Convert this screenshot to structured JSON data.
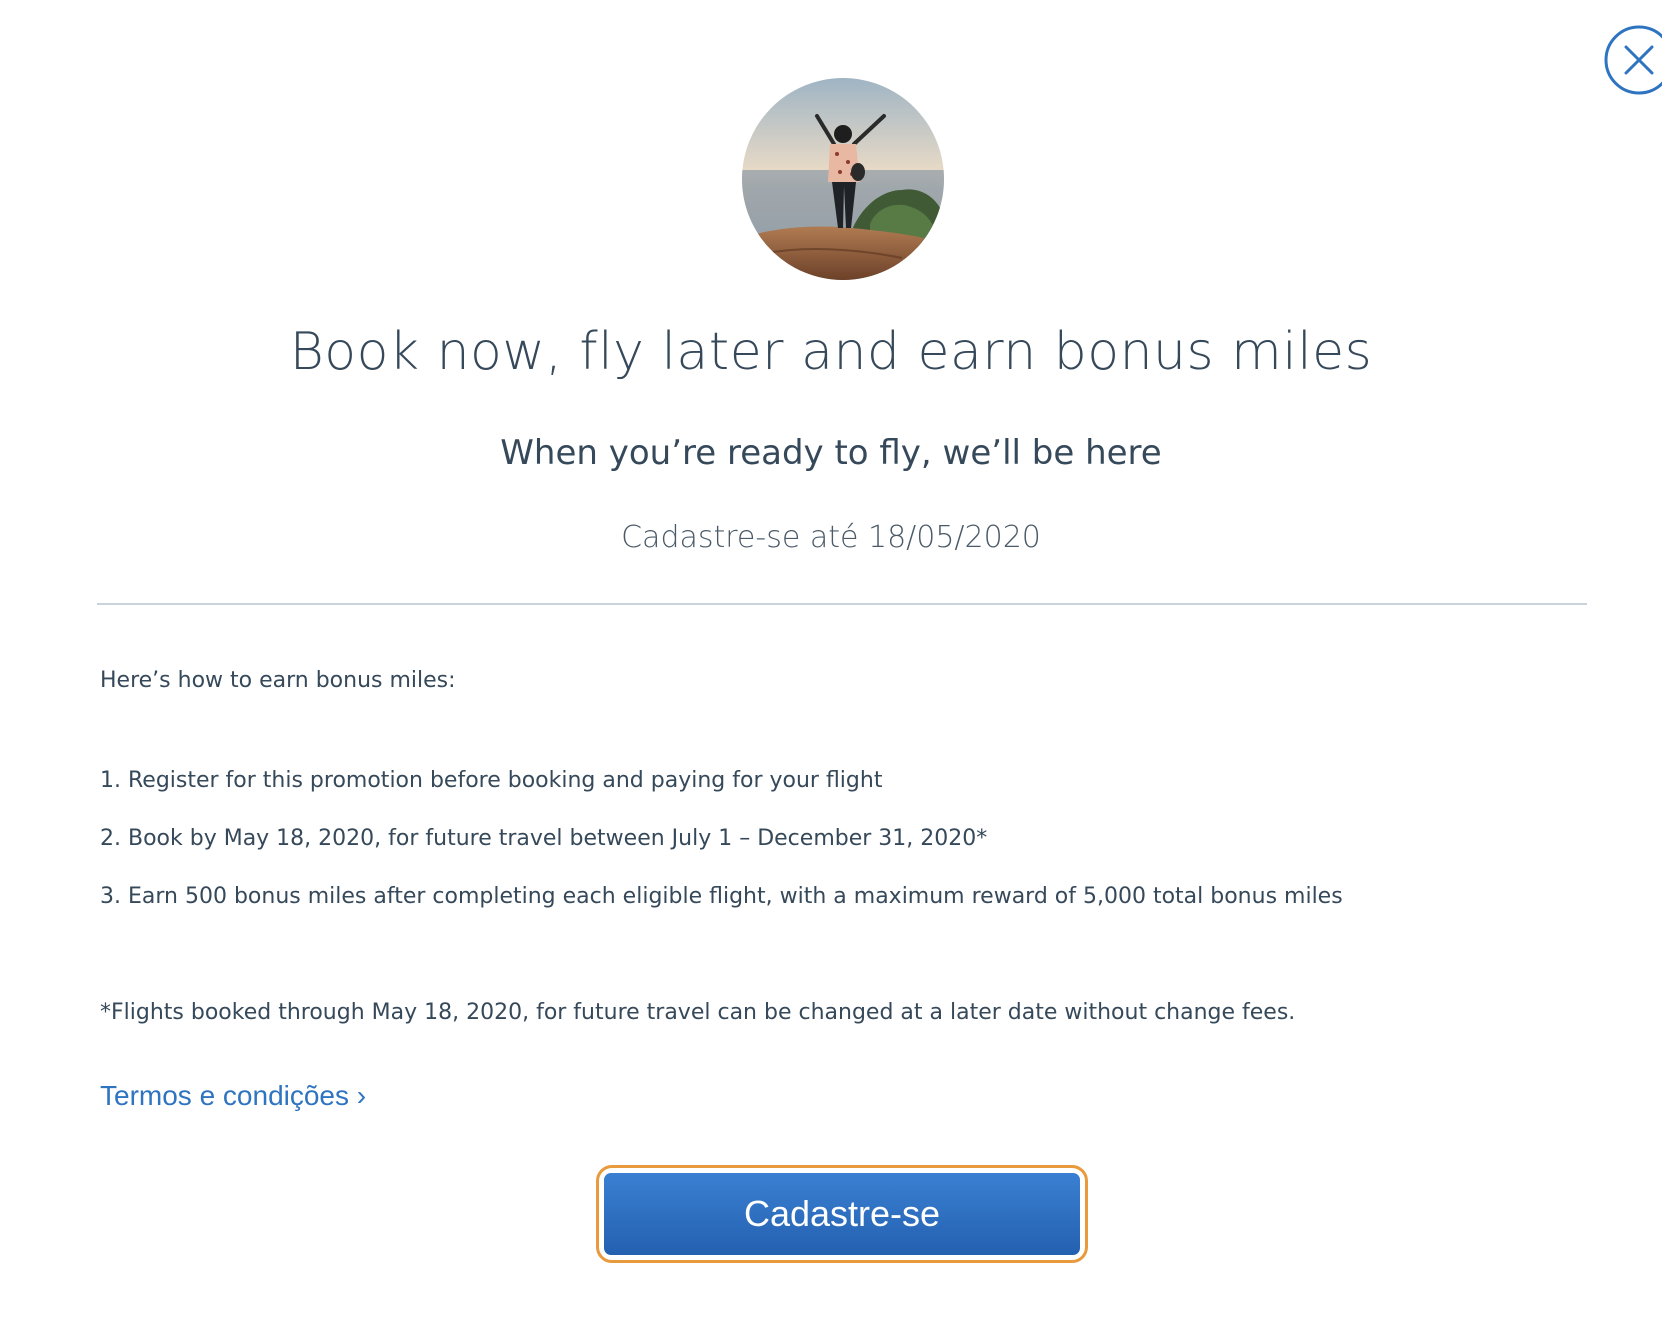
{
  "close": {
    "icon": "close-icon"
  },
  "hero": {
    "image": "woman-on-cliff-by-sea-photo"
  },
  "title": "Book now, fly later and earn bonus miles",
  "subtitle": "When you’re ready to fly, we’ll be here",
  "deadline": "Cadastre-se até 18/05/2020",
  "intro": "Here’s how to earn bonus miles:",
  "steps": [
    "1. Register for this promotion before booking and paying for your flight",
    "2. Book by May 18, 2020, for future travel between July 1 – December 31, 2020*",
    "3. Earn 500 bonus miles after completing each eligible flight, with a maximum reward of 5,000 total bonus miles"
  ],
  "footnote": "*Flights booked through May 18, 2020, for future travel can be changed at a later date without change fees.",
  "terms_link": "Termos e condições ›",
  "cta_label": "Cadastre-se",
  "colors": {
    "text": "#36495a",
    "link": "#2f74c0",
    "button": "#2a6bc0",
    "focus_ring": "#e89a3c"
  }
}
